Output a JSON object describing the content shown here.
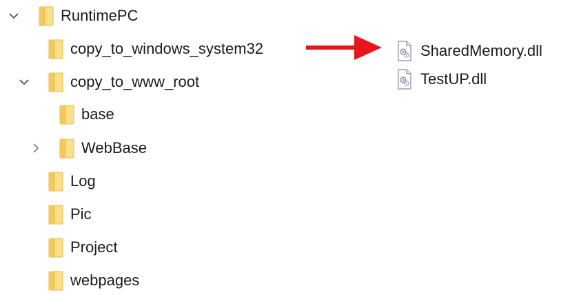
{
  "tree": {
    "root": {
      "label": "RuntimePC",
      "expanded": true
    },
    "children": [
      {
        "label": "copy_to_windows_system32"
      },
      {
        "label": "copy_to_www_root",
        "expanded": true
      },
      {
        "label": "base"
      },
      {
        "label": "WebBase",
        "expanded": false
      },
      {
        "label": "Log"
      },
      {
        "label": "Pic"
      },
      {
        "label": "Project"
      },
      {
        "label": "webpages"
      }
    ]
  },
  "files": [
    {
      "label": "SharedMemory.dll",
      "icon": "dll-file-icon"
    },
    {
      "label": "TestUP.dll",
      "icon": "dll-file-icon"
    }
  ],
  "colors": {
    "folder_fill": "#F8D775",
    "folder_edge": "#E4B84A",
    "arrow": "#E8161B",
    "text": "#1a1a1a"
  }
}
